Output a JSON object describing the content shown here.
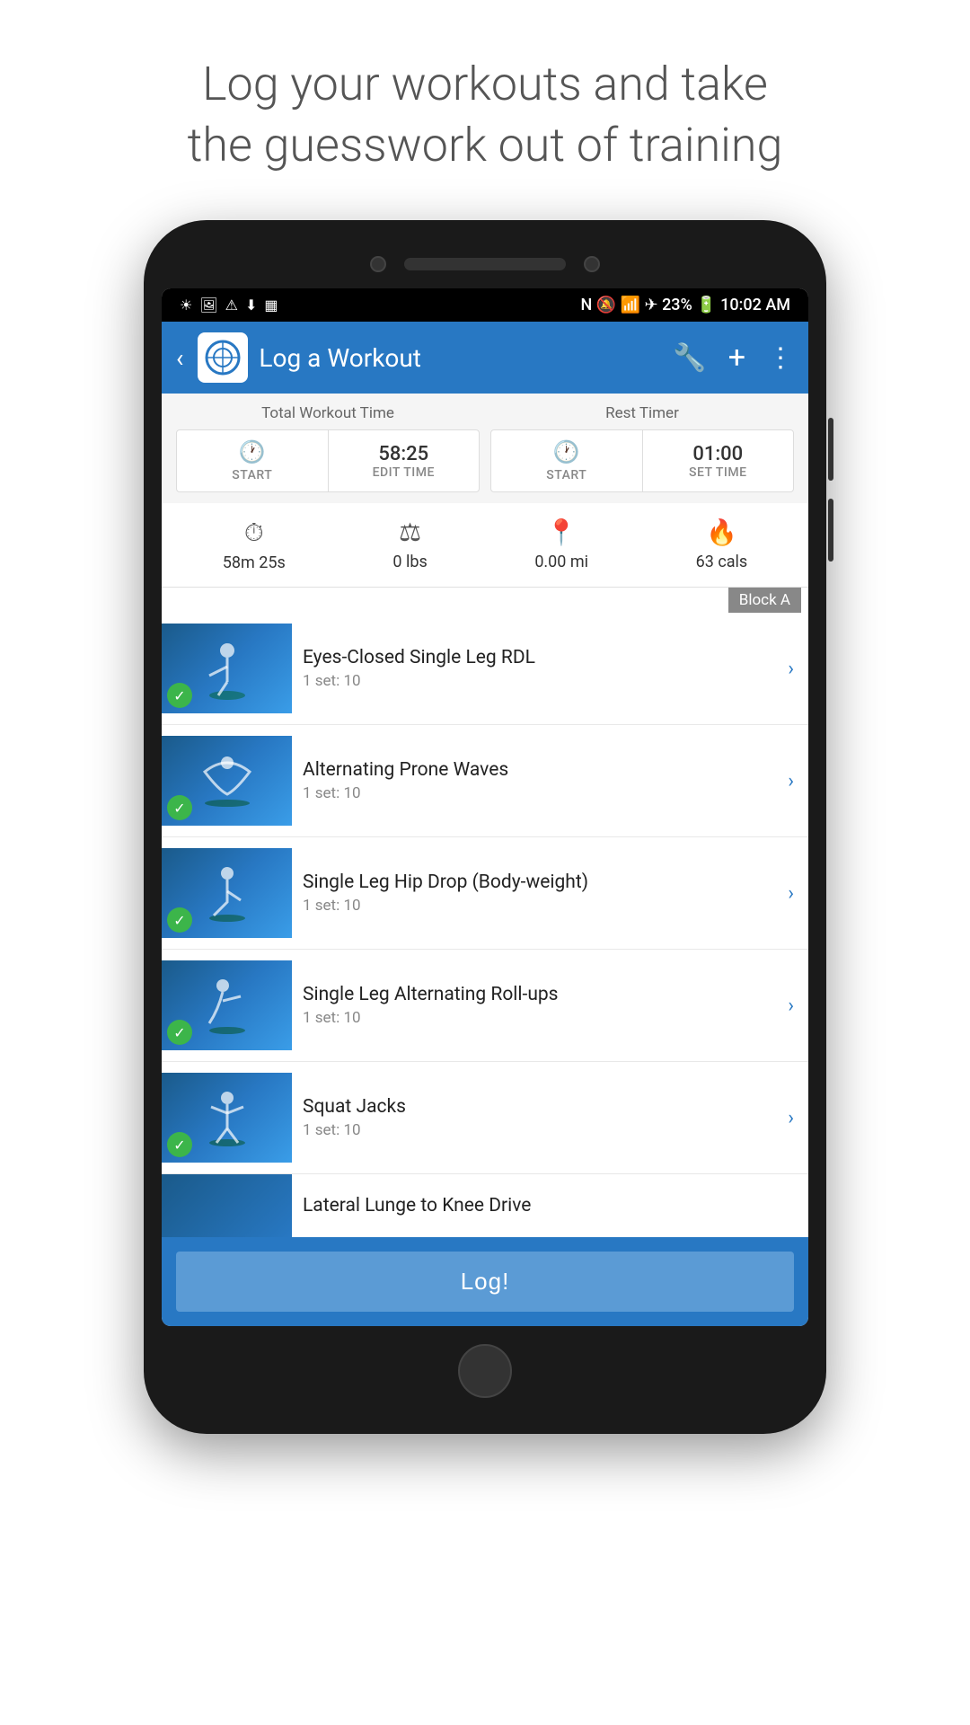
{
  "tagline": {
    "line1": "Log your workouts and take",
    "line2": "the guesswork out of training"
  },
  "status_bar": {
    "time": "10:02 AM",
    "battery": "23%",
    "signal": "▲"
  },
  "header": {
    "title": "Log a Workout",
    "back_label": "‹",
    "wrench_icon": "🔧",
    "plus_icon": "+",
    "more_icon": "⋮"
  },
  "workout_timer": {
    "label": "Total Workout Time",
    "start_label": "START",
    "time_value": "58:25",
    "edit_label": "EDIT TIME"
  },
  "rest_timer": {
    "label": "Rest Timer",
    "start_label": "START",
    "time_value": "01:00",
    "set_label": "SET TIME"
  },
  "stats": {
    "time": "58m 25s",
    "weight": "0 lbs",
    "distance": "0.00 mi",
    "calories": "63 cals"
  },
  "block_label": "Block A",
  "exercises": [
    {
      "name": "Eyes-Closed Single Leg RDL",
      "sets": "1 set: 10",
      "completed": true
    },
    {
      "name": "Alternating Prone Waves",
      "sets": "1 set: 10",
      "completed": true
    },
    {
      "name": "Single Leg Hip Drop (Body-weight)",
      "sets": "1 set: 10",
      "completed": true
    },
    {
      "name": "Single Leg Alternating Roll-ups",
      "sets": "1 set: 10",
      "completed": true
    },
    {
      "name": "Squat Jacks",
      "sets": "1 set: 10",
      "completed": true
    }
  ],
  "partial_exercise": {
    "name": "Lateral Lunge to Knee Drive"
  },
  "log_button_label": "Log!"
}
